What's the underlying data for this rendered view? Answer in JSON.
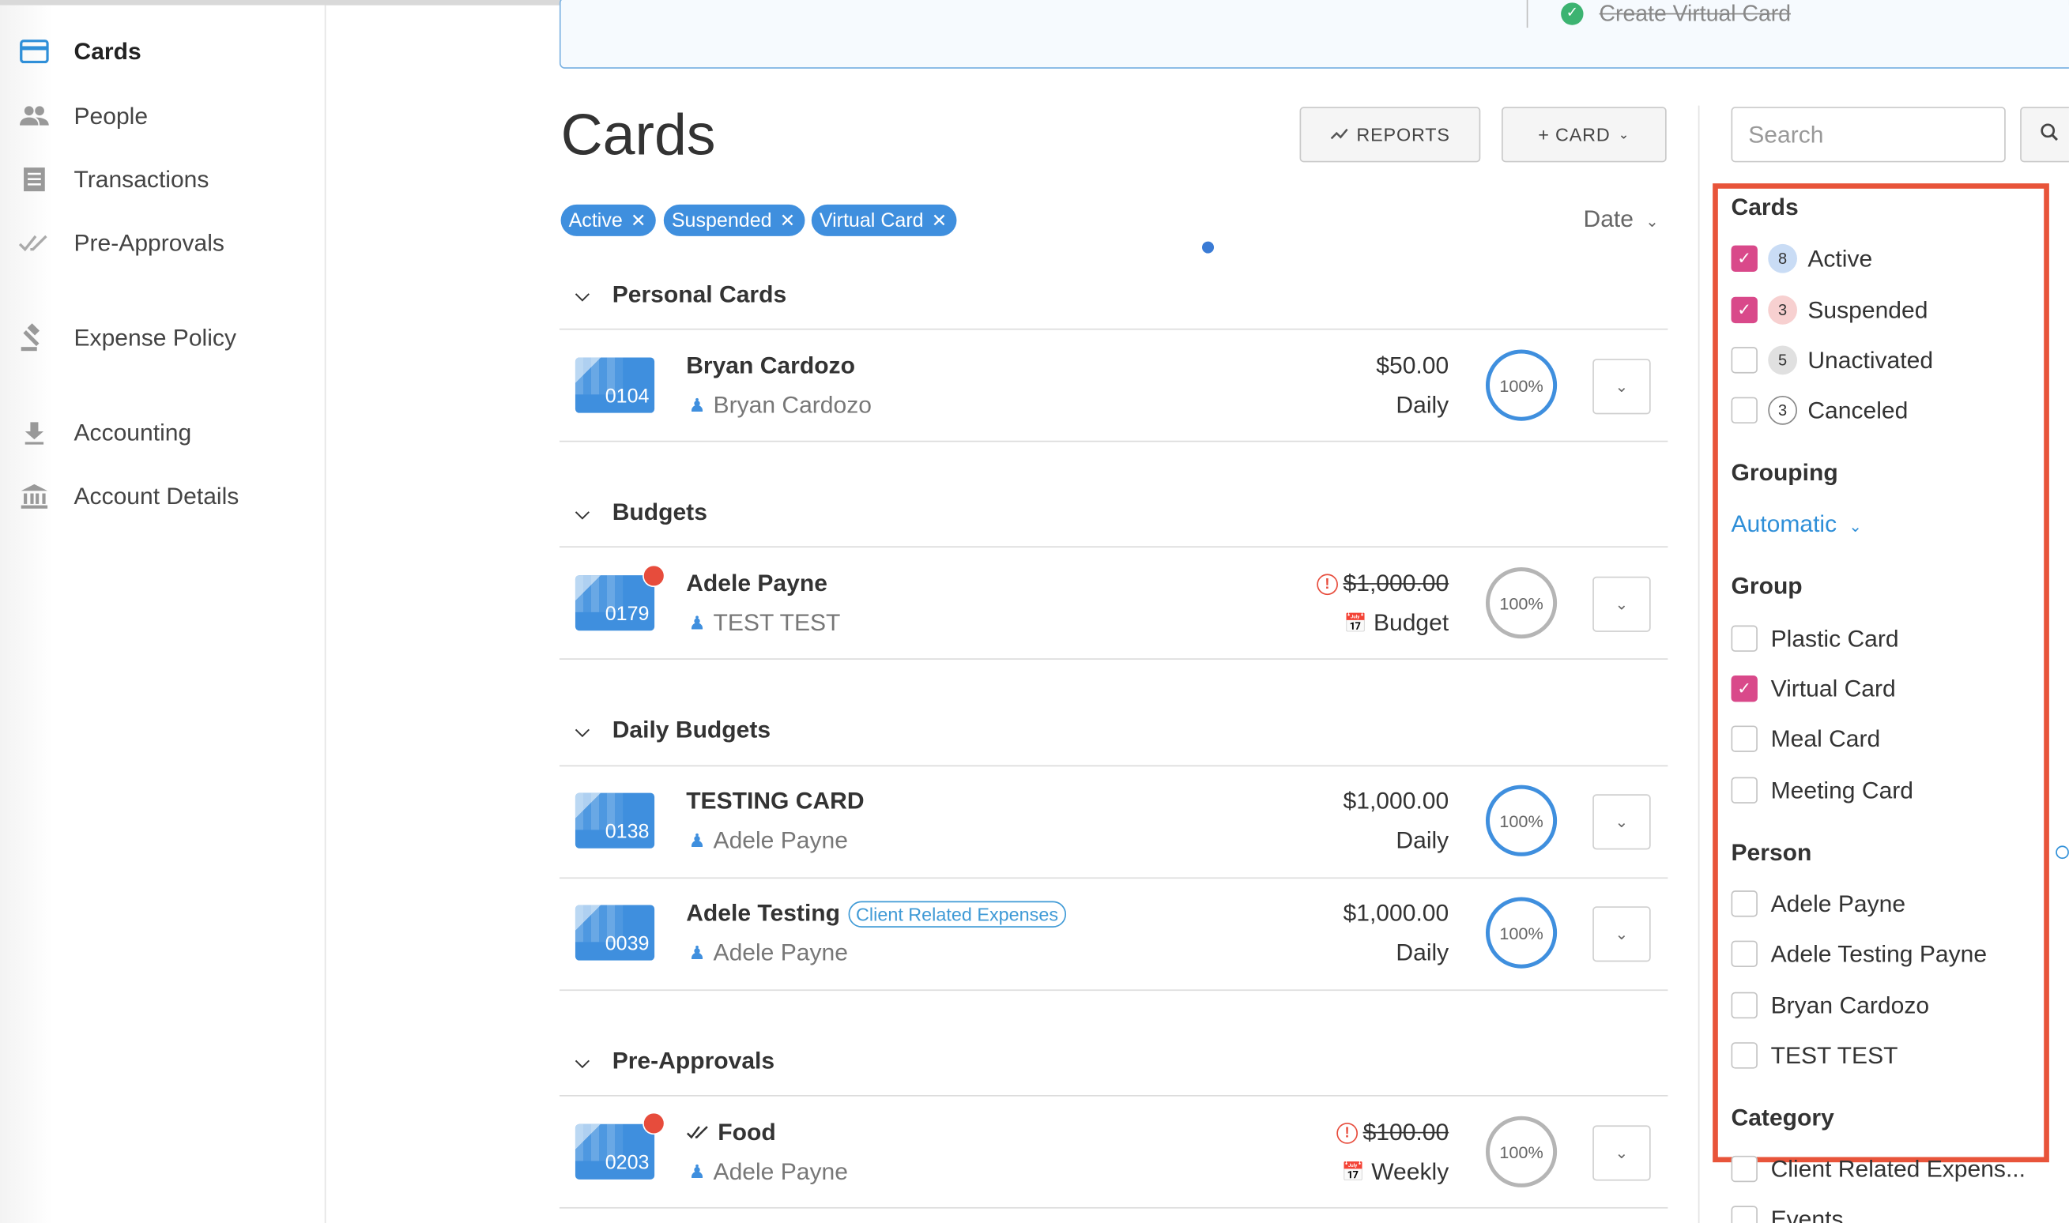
{
  "sidebar": {
    "items": [
      {
        "label": "Cards",
        "icon": "credit-card-icon",
        "active": true
      },
      {
        "label": "People",
        "icon": "people-icon"
      },
      {
        "label": "Transactions",
        "icon": "list-icon"
      },
      {
        "label": "Pre-Approvals",
        "icon": "double-check-icon"
      },
      {
        "label": "Expense Policy",
        "icon": "gavel-icon"
      },
      {
        "label": "Accounting",
        "icon": "download-icon"
      },
      {
        "label": "Account Details",
        "icon": "bank-icon"
      }
    ]
  },
  "banner": {
    "text": "Create Virtual Card",
    "status_color": "#3cb371"
  },
  "header": {
    "title": "Cards",
    "reports_label": "REPORTS",
    "card_label": "+ CARD"
  },
  "filters": {
    "chips": [
      "Active",
      "Suspended",
      "Virtual Card"
    ],
    "sort_label": "Date"
  },
  "sections": [
    {
      "title": "Personal Cards",
      "rows": [
        {
          "last4": "0104",
          "name": "Bryan Cardozo",
          "person": "Bryan Cardozo",
          "amount": "$50.00",
          "period": "Daily",
          "percent": "100%",
          "alert": false,
          "over": false
        }
      ]
    },
    {
      "title": "Budgets",
      "rows": [
        {
          "last4": "0179",
          "name": "Adele Payne",
          "person": "TEST TEST",
          "amount": "$1,000.00",
          "period": "Budget",
          "percent": "100%",
          "alert": true,
          "over": true
        }
      ]
    },
    {
      "title": "Daily Budgets",
      "rows": [
        {
          "last4": "0138",
          "name": "TESTING CARD",
          "person": "Adele Payne",
          "amount": "$1,000.00",
          "period": "Daily",
          "percent": "100%",
          "alert": false,
          "over": false
        },
        {
          "last4": "0039",
          "name": "Adele Testing",
          "tag": "Client Related Expenses",
          "person": "Adele Payne",
          "amount": "$1,000.00",
          "period": "Daily",
          "percent": "100%",
          "alert": false,
          "over": false
        }
      ]
    },
    {
      "title": "Pre-Approvals",
      "rows": [
        {
          "last4": "0203",
          "name": "Food",
          "person": "Adele Payne",
          "amount": "$100.00",
          "period": "Weekly",
          "percent": "100%",
          "alert": true,
          "over": true
        }
      ]
    }
  ],
  "filter_panel": {
    "search_placeholder": "Search",
    "cards": {
      "heading": "Cards",
      "items": [
        {
          "label": "Active",
          "count": "8",
          "checked": true
        },
        {
          "label": "Suspended",
          "count": "3",
          "checked": true
        },
        {
          "label": "Unactivated",
          "count": "5",
          "checked": false
        },
        {
          "label": "Canceled",
          "count": "3",
          "checked": false
        }
      ]
    },
    "grouping": {
      "heading": "Grouping",
      "value": "Automatic"
    },
    "group": {
      "heading": "Group",
      "items": [
        {
          "label": "Plastic Card",
          "checked": false
        },
        {
          "label": "Virtual Card",
          "checked": true
        },
        {
          "label": "Meal Card",
          "checked": false
        },
        {
          "label": "Meeting Card",
          "checked": false
        }
      ]
    },
    "person": {
      "heading": "Person",
      "items": [
        {
          "label": "Adele Payne",
          "checked": false
        },
        {
          "label": "Adele Testing Payne",
          "checked": false
        },
        {
          "label": "Bryan Cardozo",
          "checked": false
        },
        {
          "label": "TEST TEST",
          "checked": false
        }
      ]
    },
    "category": {
      "heading": "Category",
      "items": [
        {
          "label": "Client Related Expens...",
          "checked": false
        },
        {
          "label": "Events",
          "checked": false
        }
      ]
    }
  },
  "colors": {
    "accent": "#3f8fde",
    "check": "#d9498a",
    "highlight": "#e8543a",
    "alert": "#e74c3c"
  }
}
